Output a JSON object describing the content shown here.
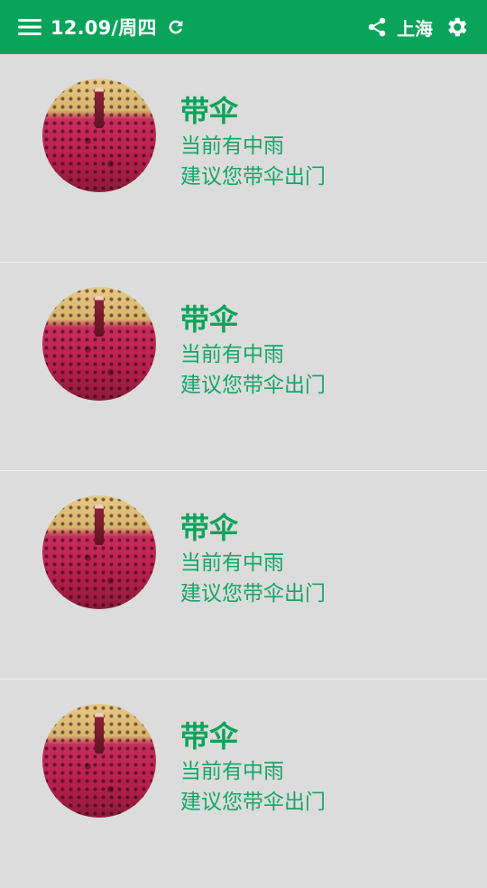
{
  "header": {
    "date": "12.09/周四",
    "city": "上海",
    "icons": {
      "menu": "hamburger-menu-icon",
      "refresh": "refresh-icon",
      "share": "share-icon",
      "settings": "gear-icon"
    }
  },
  "cards": [
    {
      "title": "带伞",
      "line1": "当前有中雨",
      "line2": "建议您带伞出门"
    },
    {
      "title": "带伞",
      "line1": "当前有中雨",
      "line2": "建议您带伞出门"
    },
    {
      "title": "带伞",
      "line1": "当前有中雨",
      "line2": "建议您带伞出门"
    },
    {
      "title": "带伞",
      "line1": "当前有中雨",
      "line2": "建议您带伞出门"
    }
  ],
  "colors": {
    "accent": "#0aa35a",
    "background": "#dcdcdc",
    "divider": "#f2f2f2"
  }
}
